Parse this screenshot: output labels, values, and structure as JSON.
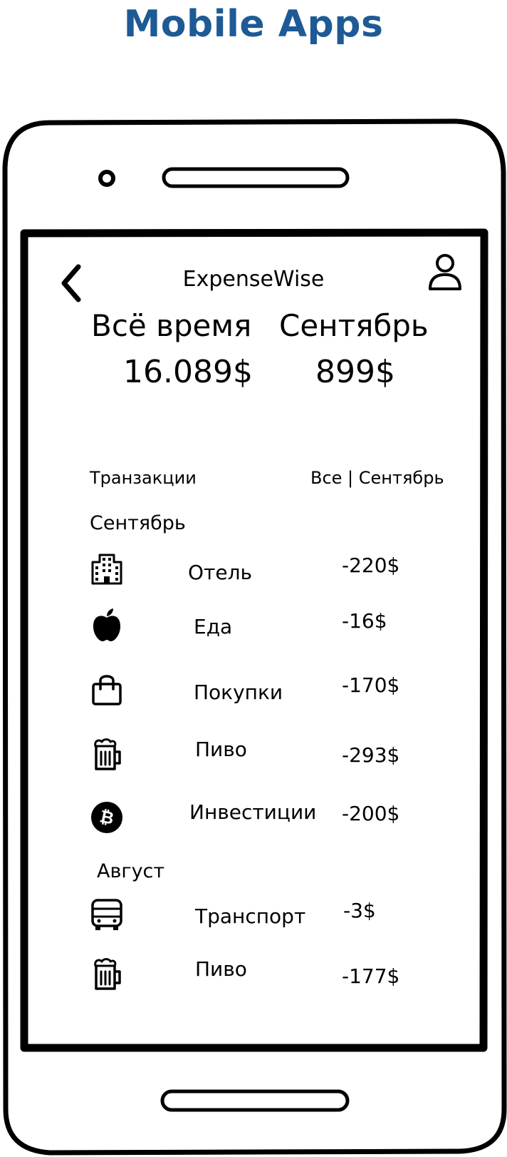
{
  "page_heading": "Mobile Apps",
  "header": {
    "title": "ExpenseWise"
  },
  "stats": {
    "all_time": {
      "label": "Всё время",
      "value": "16.089$"
    },
    "month": {
      "label": "Сентябрь",
      "value": "899$"
    }
  },
  "transactions": {
    "title": "Транзакции",
    "filter": "Все | Сентябрь",
    "groups": [
      {
        "name": "Сентябрь",
        "items": [
          {
            "category": "Отель",
            "amount": "-220$",
            "icon": "building-icon"
          },
          {
            "category": "Еда",
            "amount": "-16$",
            "icon": "apple-icon"
          },
          {
            "category": "Покупки",
            "amount": "-170$",
            "icon": "shopping-bag-icon"
          },
          {
            "category": "Пиво",
            "amount": "-293$",
            "icon": "beer-mug-icon"
          },
          {
            "category": "Инвестиции",
            "amount": "-200$",
            "icon": "bitcoin-icon"
          }
        ]
      },
      {
        "name": "Август",
        "items": [
          {
            "category": "Транспорт",
            "amount": "-3$",
            "icon": "bus-icon"
          },
          {
            "category": "Пиво",
            "amount": "-177$",
            "icon": "beer-mug-icon"
          }
        ]
      }
    ]
  },
  "colors": {
    "heading": "#1d5a96",
    "ink": "#000000",
    "background": "#ffffff"
  }
}
